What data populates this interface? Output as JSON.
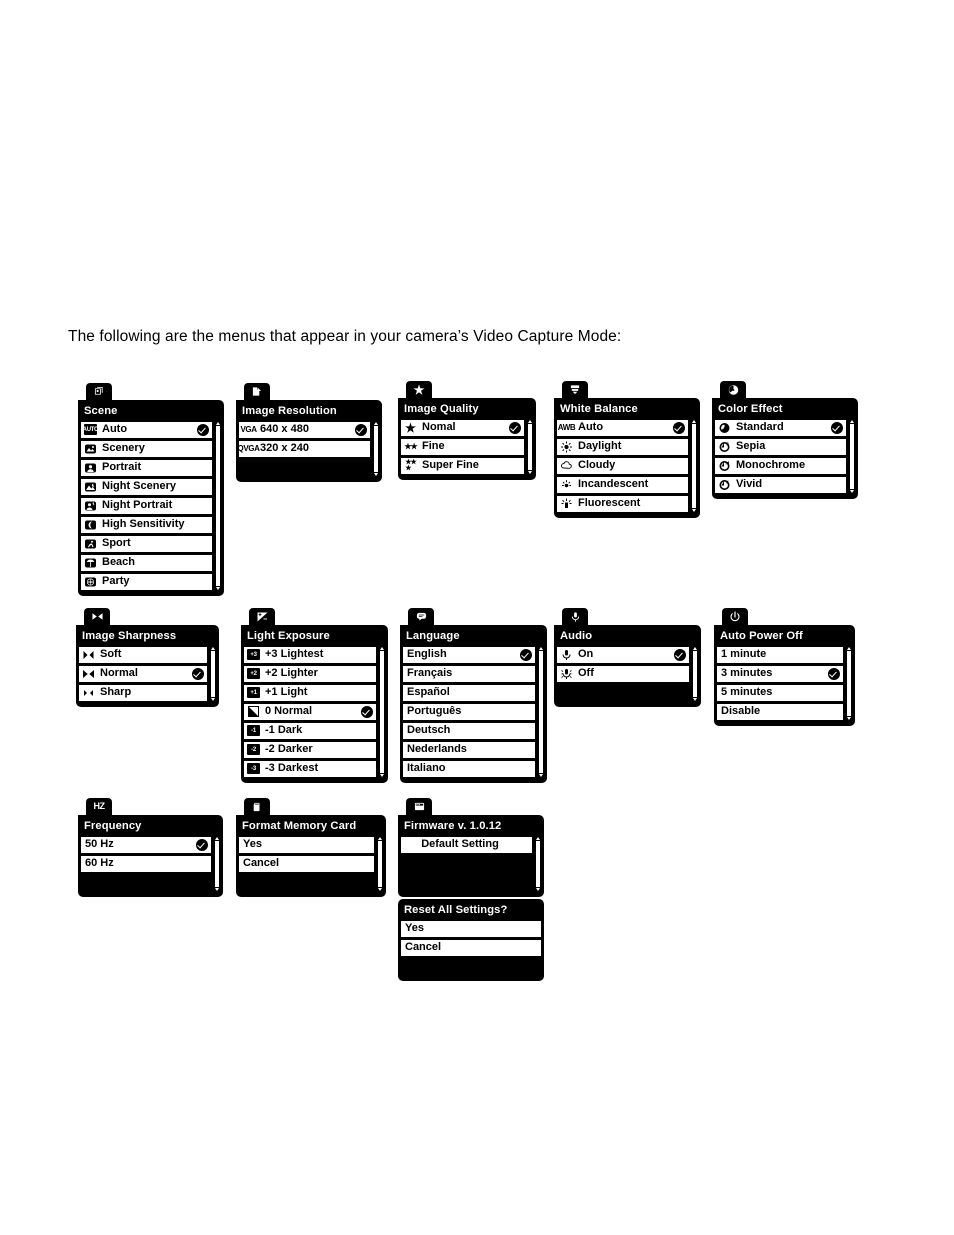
{
  "page": {
    "intro": "The following are the menus that appear in your camera’s Video Capture Mode:"
  },
  "menus": [
    {
      "id": "scene",
      "tab_icon": "scene-icon",
      "title": "Scene",
      "scrollbar": true,
      "rows": [
        {
          "icon": "auto-badge-icon",
          "label": "Auto",
          "checked": true
        },
        {
          "icon": "scenery-icon",
          "label": "Scenery",
          "checked": false
        },
        {
          "icon": "portrait-icon",
          "label": "Portrait",
          "checked": false
        },
        {
          "icon": "night-scenery-icon",
          "label": "Night Scenery",
          "checked": false
        },
        {
          "icon": "night-portrait-icon",
          "label": "Night Portrait",
          "checked": false
        },
        {
          "icon": "high-sensitivity-icon",
          "label": "High Sensitivity",
          "checked": false
        },
        {
          "icon": "sport-icon",
          "label": "Sport",
          "checked": false
        },
        {
          "icon": "beach-icon",
          "label": "Beach",
          "checked": false
        },
        {
          "icon": "party-icon",
          "label": "Party",
          "checked": false
        }
      ]
    },
    {
      "id": "image-resolution",
      "tab_icon": "resolution-icon",
      "title": "Image Resolution",
      "scrollbar": true,
      "rows": [
        {
          "icon": "vga-icon",
          "label": "640 x 480",
          "checked": true
        },
        {
          "icon": "qvga-icon",
          "label": "320 x 240",
          "checked": false
        }
      ],
      "filler": 1
    },
    {
      "id": "image-quality",
      "tab_icon": "star-icon",
      "title": "Image Quality",
      "scrollbar": true,
      "rows": [
        {
          "icon": "one-star-icon",
          "label": "Nomal",
          "checked": true
        },
        {
          "icon": "two-star-icon",
          "label": "Fine",
          "checked": false
        },
        {
          "icon": "three-star-icon",
          "label": "Super Fine",
          "checked": false
        }
      ]
    },
    {
      "id": "white-balance",
      "tab_icon": "white-balance-icon",
      "title": "White Balance",
      "scrollbar": true,
      "rows": [
        {
          "icon": "awb-icon",
          "label": "Auto",
          "checked": true
        },
        {
          "icon": "daylight-icon",
          "label": "Daylight",
          "checked": false
        },
        {
          "icon": "cloudy-icon",
          "label": "Cloudy",
          "checked": false
        },
        {
          "icon": "incandescent-icon",
          "label": "Incandescent",
          "checked": false
        },
        {
          "icon": "fluorescent-icon",
          "label": "Fluorescent",
          "checked": false
        }
      ]
    },
    {
      "id": "color-effect",
      "tab_icon": "color-effect-icon",
      "title": "Color Effect",
      "scrollbar": true,
      "rows": [
        {
          "icon": "standard-color-icon",
          "label": "Standard",
          "checked": true
        },
        {
          "icon": "sepia-icon",
          "label": "Sepia",
          "checked": false
        },
        {
          "icon": "monochrome-icon",
          "label": "Monochrome",
          "checked": false
        },
        {
          "icon": "vivid-icon",
          "label": "Vivid",
          "checked": false
        }
      ]
    },
    {
      "id": "image-sharpness",
      "tab_icon": "sharpness-icon",
      "title": "Image Sharpness",
      "scrollbar": true,
      "rows": [
        {
          "icon": "soft-icon",
          "label": "Soft",
          "checked": false
        },
        {
          "icon": "normal-sharp-icon",
          "label": "Normal",
          "checked": true
        },
        {
          "icon": "sharp-icon",
          "label": "Sharp",
          "checked": false
        }
      ]
    },
    {
      "id": "light-exposure",
      "tab_icon": "exposure-icon",
      "title": "Light Exposure",
      "scrollbar": true,
      "rows": [
        {
          "icon": "ev-plus3-icon",
          "label": "+3 Lightest",
          "checked": false
        },
        {
          "icon": "ev-plus2-icon",
          "label": "+2 Lighter",
          "checked": false
        },
        {
          "icon": "ev-plus1-icon",
          "label": "+1 Light",
          "checked": false
        },
        {
          "icon": "ev-zero-icon",
          "label": "0 Normal",
          "checked": true
        },
        {
          "icon": "ev-minus1-icon",
          "label": "-1 Dark",
          "checked": false
        },
        {
          "icon": "ev-minus2-icon",
          "label": "-2 Darker",
          "checked": false
        },
        {
          "icon": "ev-minus3-icon",
          "label": "-3 Darkest",
          "checked": false
        }
      ]
    },
    {
      "id": "language",
      "tab_icon": "language-icon",
      "title": "Language",
      "scrollbar": true,
      "rows": [
        {
          "icon": "",
          "label": "English",
          "checked": true
        },
        {
          "icon": "",
          "label": "Français",
          "checked": false
        },
        {
          "icon": "",
          "label": "Español",
          "checked": false
        },
        {
          "icon": "",
          "label": "Português",
          "checked": false
        },
        {
          "icon": "",
          "label": "Deutsch",
          "checked": false
        },
        {
          "icon": "",
          "label": "Nederlands",
          "checked": false
        },
        {
          "icon": "",
          "label": "Italiano",
          "checked": false
        }
      ]
    },
    {
      "id": "audio",
      "tab_icon": "microphone-icon",
      "title": "Audio",
      "scrollbar": true,
      "rows": [
        {
          "icon": "mic-on-icon",
          "label": "On",
          "checked": true
        },
        {
          "icon": "mic-off-icon",
          "label": "Off",
          "checked": false
        }
      ],
      "filler": 1
    },
    {
      "id": "auto-power-off",
      "tab_icon": "power-icon",
      "title": "Auto Power Off",
      "scrollbar": true,
      "rows": [
        {
          "icon": "",
          "label": "1 minute",
          "checked": false
        },
        {
          "icon": "",
          "label": "3 minutes",
          "checked": true
        },
        {
          "icon": "",
          "label": "5 minutes",
          "checked": false
        },
        {
          "icon": "",
          "label": "Disable",
          "checked": false
        }
      ]
    },
    {
      "id": "frequency",
      "tab_icon": "hz-icon",
      "title": "Frequency",
      "scrollbar": true,
      "rows": [
        {
          "icon": "",
          "label": "50 Hz",
          "checked": true
        },
        {
          "icon": "",
          "label": "60 Hz",
          "checked": false
        }
      ],
      "filler": 1
    },
    {
      "id": "format-memory-card",
      "tab_icon": "sd-card-icon",
      "title": "Format Memory Card",
      "scrollbar": true,
      "rows": [
        {
          "icon": "",
          "label": "Yes",
          "checked": false
        },
        {
          "icon": "",
          "label": "Cancel",
          "checked": false
        }
      ],
      "filler": 1
    },
    {
      "id": "firmware",
      "tab_icon": "firmware-icon",
      "title": "Firmware v. 1.0.12",
      "scrollbar": true,
      "rows": [
        {
          "icon": "",
          "label": "Default Setting",
          "checked": false,
          "center": true
        }
      ],
      "filler": 2
    },
    {
      "id": "reset-all-settings",
      "tab_icon": "",
      "title": "Reset All Settings?",
      "scrollbar": false,
      "rows": [
        {
          "icon": "",
          "label": "Yes",
          "checked": false
        },
        {
          "icon": "",
          "label": "Cancel",
          "checked": false
        }
      ],
      "filler": 1
    }
  ]
}
